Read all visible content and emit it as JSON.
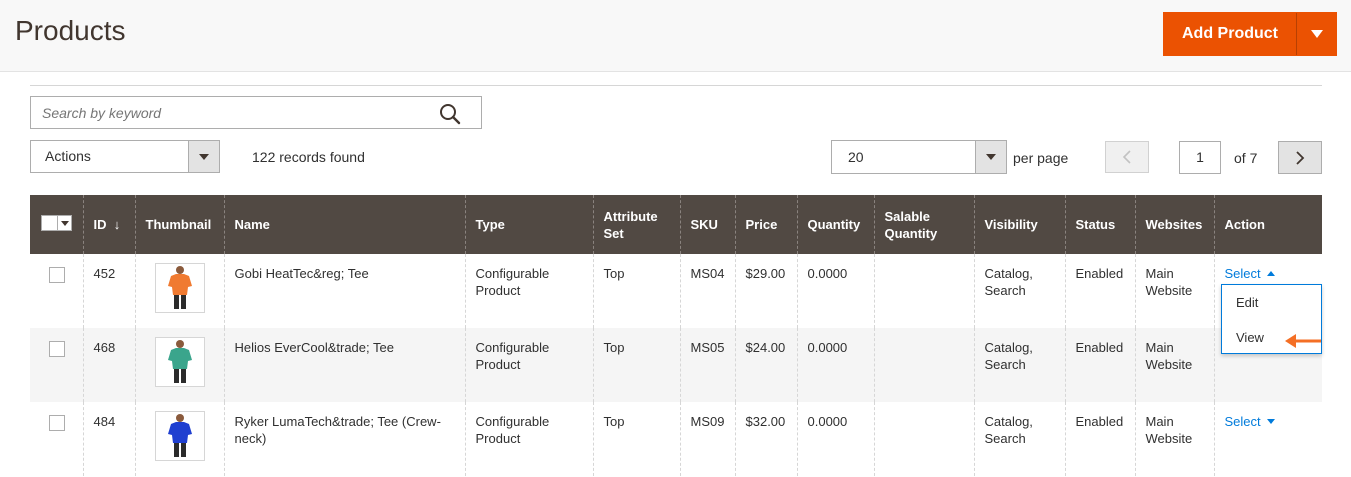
{
  "header": {
    "title": "Products",
    "add_button": "Add Product"
  },
  "toolbar": {
    "search_placeholder": "Search by keyword",
    "actions_label": "Actions",
    "records_found": "122 records found",
    "per_page_value": "20",
    "per_page_label": "per page",
    "current_page": "1",
    "page_total": "of 7"
  },
  "columns": [
    "ID",
    "Thumbnail",
    "Name",
    "Type",
    "Attribute Set",
    "SKU",
    "Price",
    "Quantity",
    "Salable Quantity",
    "Visibility",
    "Status",
    "Websites",
    "Action"
  ],
  "rows": [
    {
      "id": "452",
      "name": "Gobi HeatTec&reg; Tee",
      "type": "Configurable Product",
      "attribute_set": "Top",
      "sku": "MS04",
      "price": "$29.00",
      "quantity": "0.0000",
      "salable_quantity": "",
      "visibility": "Catalog, Search",
      "status": "Enabled",
      "websites": "Main Website",
      "action": "Select",
      "shirt_color": "#f07a30"
    },
    {
      "id": "468",
      "name": "Helios EverCool&trade; Tee",
      "type": "Configurable Product",
      "attribute_set": "Top",
      "sku": "MS05",
      "price": "$24.00",
      "quantity": "0.0000",
      "salable_quantity": "",
      "visibility": "Catalog, Search",
      "status": "Enabled",
      "websites": "Main Website",
      "action": "",
      "shirt_color": "#3aa58c"
    },
    {
      "id": "484",
      "name": "Ryker LumaTech&trade; Tee (Crew-neck)",
      "type": "Configurable Product",
      "attribute_set": "Top",
      "sku": "MS09",
      "price": "$32.00",
      "quantity": "0.0000",
      "salable_quantity": "",
      "visibility": "Catalog, Search",
      "status": "Enabled",
      "websites": "Main Website",
      "action": "Select",
      "shirt_color": "#1f3fd0"
    }
  ],
  "action_menu": {
    "edit": "Edit",
    "view": "View"
  },
  "colors": {
    "accent": "#eb5202",
    "header_bg": "#514943",
    "link": "#007bdb",
    "arrow": "#f46f25"
  }
}
